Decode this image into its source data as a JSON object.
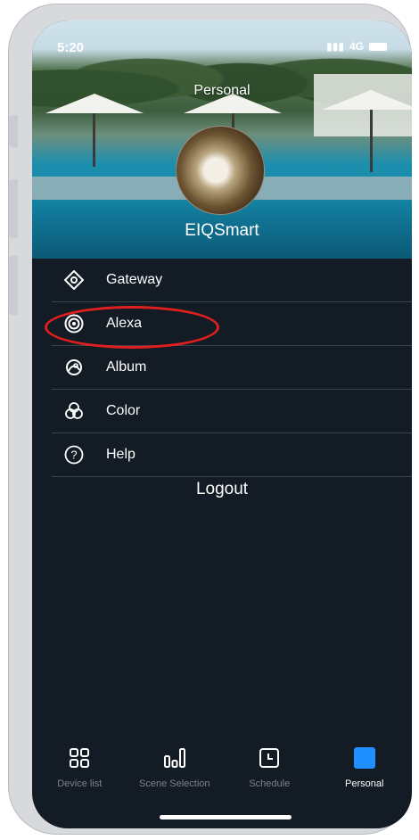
{
  "status_bar": {
    "time": "5:20",
    "network": "4G"
  },
  "header": {
    "title": "Personal",
    "username": "EIQSmart"
  },
  "menu": [
    {
      "label": "Gateway",
      "icon": "diamond-icon"
    },
    {
      "label": "Alexa",
      "icon": "alexa-ring-icon"
    },
    {
      "label": "Album",
      "icon": "album-icon"
    },
    {
      "label": "Color",
      "icon": "color-circles-icon"
    },
    {
      "label": "Help",
      "icon": "help-icon"
    }
  ],
  "logout_label": "Logout",
  "tabs": [
    {
      "label": "Device list",
      "icon": "grid-icon"
    },
    {
      "label": "Scene Selection",
      "icon": "bars-icon"
    },
    {
      "label": "Schedule",
      "icon": "clock-icon"
    },
    {
      "label": "Personal",
      "icon": "person-square-icon"
    }
  ],
  "colors": {
    "background": "#131b24",
    "accent": "#1e90ff",
    "highlight_ring": "#e11f1f",
    "inactive_tab": "#7c838c"
  }
}
